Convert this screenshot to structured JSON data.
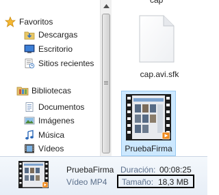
{
  "navigation": {
    "favorites_label": "Favoritos",
    "favorites_items": [
      {
        "label": "Descargas",
        "icon": "downloads-folder-icon"
      },
      {
        "label": "Escritorio",
        "icon": "desktop-icon"
      },
      {
        "label": "Sitios recientes",
        "icon": "recent-places-icon"
      }
    ],
    "libraries_label": "Bibliotecas",
    "libraries_items": [
      {
        "label": "Documentos",
        "icon": "documents-icon"
      },
      {
        "label": "Imágenes",
        "icon": "pictures-icon"
      },
      {
        "label": "Música",
        "icon": "music-icon"
      },
      {
        "label": "Vídeos",
        "icon": "videos-icon"
      }
    ]
  },
  "files": {
    "partial_top_label": "cap",
    "items": [
      {
        "name": "cap.avi.sfk",
        "type": "generic-file-icon",
        "selected": false
      },
      {
        "name": "PruebaFirma",
        "type": "video-thumbnail",
        "selected": true
      }
    ]
  },
  "details": {
    "file_name": "PruebaFirma",
    "file_type": "Vídeo MP4",
    "duration_label": "Duración:",
    "duration_value": "00:08:25",
    "size_label": "Tamaño:",
    "size_value": "18,3 MB"
  },
  "colors": {
    "selection_fill": "#cce8ff",
    "selection_border": "#99c9ef",
    "details_label": "#5a6e8a",
    "highlight_box_border": "#000000"
  }
}
